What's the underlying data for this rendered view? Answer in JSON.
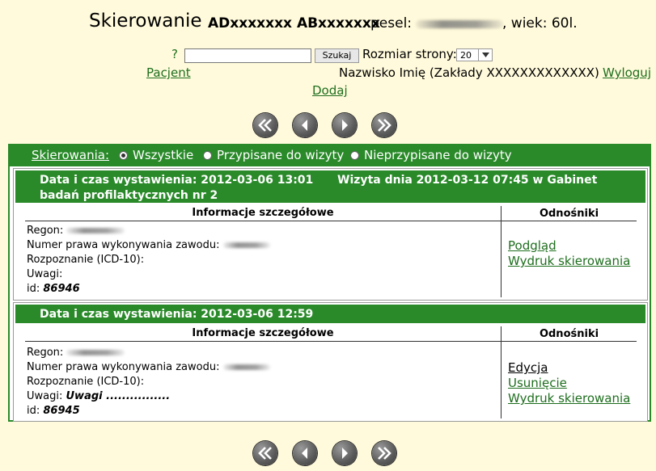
{
  "header": {
    "title": "Skierowanie",
    "patient_code": "ADxxxxxxx ABxxxxxxx",
    "pesel_label": "pesel:",
    "age_text": ", wiek: 60l."
  },
  "search": {
    "help": "?",
    "value": "",
    "button": "Szukaj",
    "page_size_label": "Rozmiar strony:",
    "page_size_value": "20"
  },
  "nav": {
    "patient_link": "Pacjent",
    "user_name": "Nazwisko Imię (Zakłady XXXXXXXXXXXXX)",
    "logout_link": "Wyloguj",
    "add_link": "Dodaj"
  },
  "filter": {
    "label": "Skierowania:",
    "options": [
      "Wszystkie",
      "Przypisane do wizyty",
      "Nieprzypisane do wizyty"
    ],
    "selected": "Wszystkie"
  },
  "table_headers": {
    "details": "Informacje szczegółowe",
    "refs": "Odnośniki"
  },
  "labels": {
    "regon": "Regon:",
    "license": "Numer prawa wykonywania zawodu:",
    "diagnosis": "Rozpoznanie (ICD-10):",
    "notes": "Uwagi:",
    "id": "id:"
  },
  "referrals": [
    {
      "issued": "Data i czas wystawienia: 2012-03-06 13:01",
      "visit": "Wizyta dnia 2012-03-12 07:45 w Gabinet badań profilaktycznych nr 2",
      "notes": "",
      "id": "86946",
      "links": [
        "Podgląd",
        "Wydruk skierowania"
      ]
    },
    {
      "issued": "Data i czas wystawienia: 2012-03-06 12:59",
      "visit": "",
      "notes": "Uwagi ................",
      "id": "86945",
      "links": [
        "Edycja",
        "Usunięcie",
        "Wydruk skierowania"
      ]
    }
  ],
  "colors": {
    "background": "#fffadb",
    "green": "#2a8a2a",
    "link": "#1e6e1e"
  },
  "icons": [
    "first-page-icon",
    "previous-page-icon",
    "next-page-icon",
    "last-page-icon"
  ]
}
